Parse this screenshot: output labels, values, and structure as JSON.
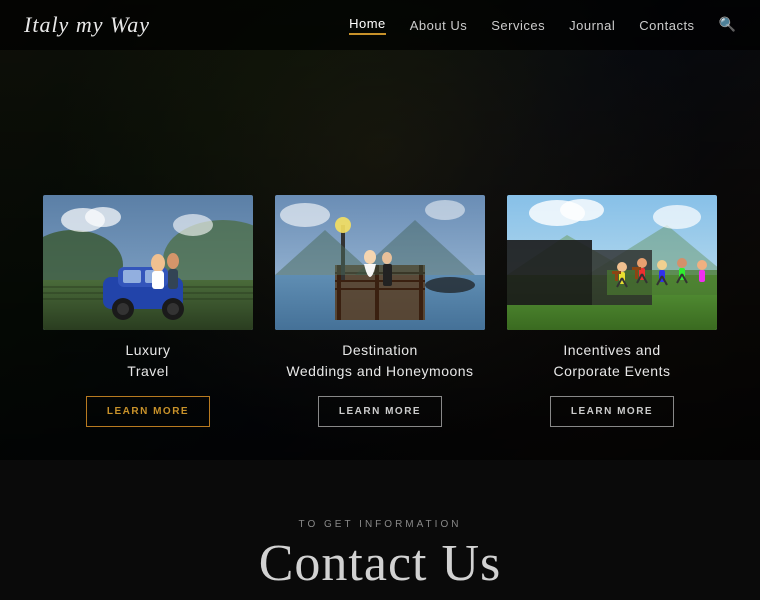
{
  "header": {
    "logo": "Italy my Way",
    "nav": {
      "home": "Home",
      "about_us": "About Us",
      "services": "Services",
      "journal": "Journal",
      "contacts": "Contacts"
    }
  },
  "cards": [
    {
      "title_line1": "Luxury",
      "title_line2": "Travel",
      "button_label": "LEARN MORE",
      "scene": "luxury-travel"
    },
    {
      "title_line1": "Destination",
      "title_line2": "Weddings and Honeymoons",
      "button_label": "LEARN MORE",
      "scene": "weddings"
    },
    {
      "title_line1": "Incentives and",
      "title_line2": "Corporate Events",
      "button_label": "LEARN MORE",
      "scene": "corporate"
    }
  ],
  "bottom": {
    "label": "TO GET INFORMATION",
    "heading": "Contact Us"
  }
}
